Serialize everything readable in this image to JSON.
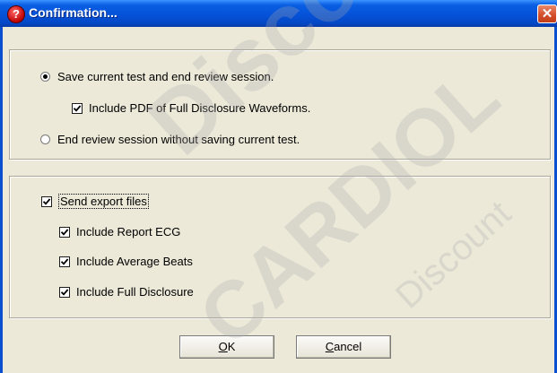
{
  "window": {
    "title": "Confirmation..."
  },
  "session_group": {
    "save_option": {
      "label": "Save current test and end review session.",
      "selected": true
    },
    "include_pdf": {
      "label": "Include PDF of Full Disclosure Waveforms.",
      "checked": true
    },
    "end_option": {
      "label": "End review session without saving current test.",
      "selected": false
    }
  },
  "export_group": {
    "send_export": {
      "label": "Send export files",
      "checked": true
    },
    "options": [
      {
        "label": "Include Report ECG",
        "checked": true
      },
      {
        "label": "Include Average Beats",
        "checked": true
      },
      {
        "label": "Include Full Disclosure",
        "checked": true
      }
    ]
  },
  "buttons": {
    "ok": {
      "mnemonic": "O",
      "rest": "K"
    },
    "cancel": {
      "mnemonic": "C",
      "rest": "ancel"
    }
  },
  "watermark": {
    "line1": "Discount",
    "line2": "CARDIOL",
    "line3": "Discount"
  }
}
